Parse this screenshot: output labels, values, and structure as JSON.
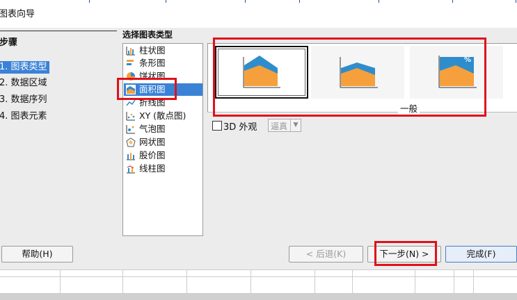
{
  "window": {
    "title": "图表向导"
  },
  "steps": {
    "heading": "步骤",
    "items": [
      "1. 图表类型",
      "2. 数据区域",
      "3. 数据序列",
      "4. 图表元素"
    ]
  },
  "chart_types": {
    "heading": "选择图表类型",
    "items": [
      {
        "label": "柱状图",
        "icon": "bar-chart-icon"
      },
      {
        "label": "条形图",
        "icon": "horizontal-bar-chart-icon"
      },
      {
        "label": "饼状图",
        "icon": "pie-chart-icon"
      },
      {
        "label": "面积图",
        "icon": "area-chart-icon"
      },
      {
        "label": "折线图",
        "icon": "line-chart-icon"
      },
      {
        "label": "XY (散点图)",
        "icon": "scatter-chart-icon"
      },
      {
        "label": "气泡图",
        "icon": "bubble-chart-icon"
      },
      {
        "label": "网状图",
        "icon": "net-chart-icon"
      },
      {
        "label": "股价图",
        "icon": "stock-chart-icon"
      },
      {
        "label": "线柱图",
        "icon": "column-line-chart-icon"
      }
    ],
    "selected_index": 3
  },
  "variants": {
    "group_label": "一般",
    "items": [
      {
        "kind": "stacked-area",
        "selected": true
      },
      {
        "kind": "stacked-area-2",
        "selected": false
      },
      {
        "kind": "percent-stacked-area",
        "selected": false,
        "badge": "%"
      }
    ]
  },
  "appearance": {
    "checkbox_label": "3D 外观",
    "combo_value": "逼真"
  },
  "buttons": {
    "help": "帮助(H)",
    "back": "< 后退(K)",
    "next": "下一步(N) >",
    "finish": "完成(F)"
  },
  "colors": {
    "selection": "#3a82d6",
    "area_blue": "#2e8dcc",
    "area_orange": "#f5a03c",
    "highlight_red": "#e0101a"
  }
}
